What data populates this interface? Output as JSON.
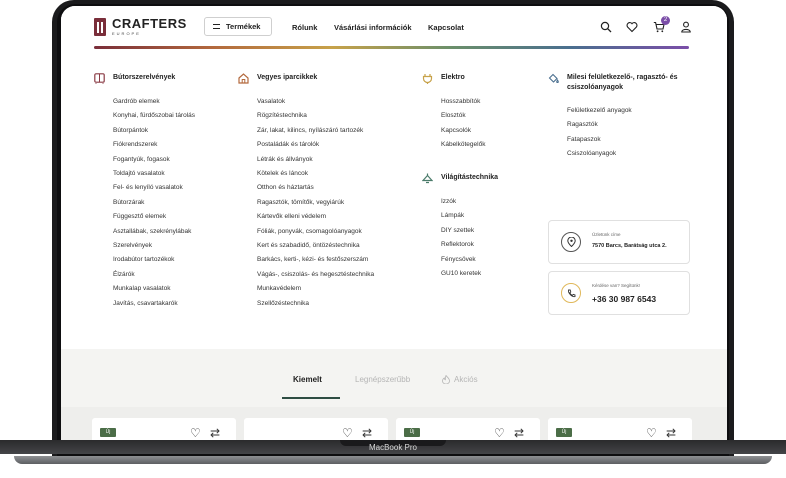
{
  "device_label": "MacBook Pro",
  "header": {
    "logo_name": "CRAFTERS",
    "logo_sub": "EUROPE",
    "products_button": "Termékek",
    "nav": [
      "Rólunk",
      "Vásárlási információk",
      "Kapcsolat"
    ],
    "cart_count": "2",
    "icons": [
      "search-icon",
      "heart-icon",
      "cart-icon",
      "user-icon"
    ],
    "accent": "#7b4ea8"
  },
  "menu": {
    "col1": {
      "title": "Bútorszerelvények",
      "icon": "cabinet-icon",
      "items": [
        "Gardrób elemek",
        "Konyhai, fürdőszobai tárolás",
        "Bútorpántok",
        "Fiókrendszerek",
        "Fogantyúk, fogasok",
        "Toldajtó vasalatok",
        "Fel- és lenyíló vasalatok",
        "Bútorzárak",
        "Függesztő elemek",
        "Asztallábak, szekrénylábak",
        "Szerelvények",
        "Irodabútor tartozékok",
        "Élzárók",
        "Munkalap vasalatok",
        "Javítás, csavartakarók"
      ]
    },
    "col2": {
      "title": "Vegyes iparcikkek",
      "icon": "house-icon",
      "items": [
        "Vasalatok",
        "Rögzítéstechnika",
        "Zár, lakat, kilincs, nyílászáró tartozék",
        "Postaládák és tárolók",
        "Létrák és állványok",
        "Kötelek és láncok",
        "Otthon és háztartás",
        "Ragasztók, tömítők, vegyiárúk",
        "Kártevők elleni védelem",
        "Fóliák, ponyvák, csomagolóanyagok",
        "Kert és szabadidő, öntözéstechnika",
        "Barkács, kerti-, kézi- és festőszerszám",
        "Vágás-, csiszolás- és hegesztéstechnika",
        "Munkavédelem",
        "Szellőzéstechnika"
      ]
    },
    "col3": {
      "title": "Elektro",
      "icon": "plug-icon",
      "items": [
        "Hosszabbítók",
        "Elosztók",
        "Kapcsolók",
        "Kábelkötegelők"
      ]
    },
    "col3b": {
      "title": "Világítástechnika",
      "icon": "lamp-icon",
      "items": [
        "Izzók",
        "Lámpák",
        "DIY szettek",
        "Reflektorok",
        "Fénycsövek",
        "GU10 keretek"
      ]
    },
    "col4": {
      "title": "Milesi felületkezelő-, ragasztó- és csiszolóanyagok",
      "icon": "paint-bucket-icon",
      "items": [
        "Felületkezelő anyagok",
        "Ragasztók",
        "Fatapaszok",
        "Csiszolóanyagok"
      ]
    },
    "address_card": {
      "label": "Üzletünk címe",
      "value": "7570 Barcs, Barátság utca 2."
    },
    "phone_card": {
      "label": "Kérdése van? Segítünk!",
      "value": "+36 30 987 6543"
    }
  },
  "tabs": [
    "Kiemelt",
    "Legnépszerűbb",
    "Akciós"
  ],
  "product_badge": "Új"
}
